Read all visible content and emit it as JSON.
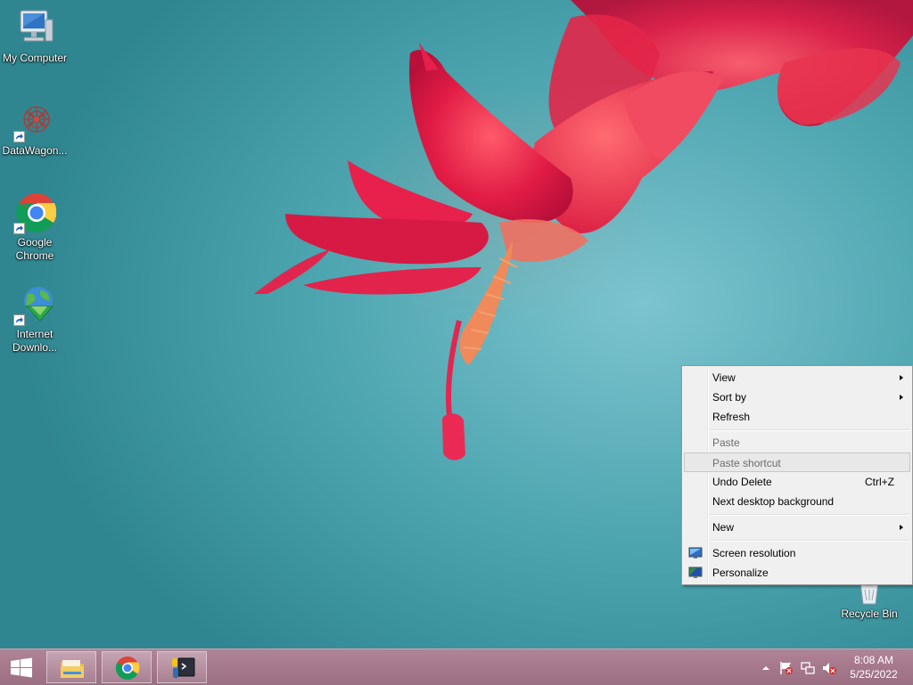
{
  "desktop": {
    "icons": [
      {
        "label": "My Computer",
        "icon": "my-computer-icon"
      },
      {
        "label": "DataWagon...",
        "icon": "datawagon-icon"
      },
      {
        "label_line1": "Google",
        "label_line2": "Chrome",
        "icon": "chrome-icon"
      },
      {
        "label_line1": "Internet",
        "label_line2": "Downlo...",
        "icon": "internet-download-manager-icon"
      },
      {
        "label": "Recycle Bin",
        "icon": "recycle-bin-icon"
      }
    ]
  },
  "context_menu": {
    "items": [
      {
        "label": "View",
        "submenu": true,
        "enabled": true
      },
      {
        "label": "Sort by",
        "submenu": true,
        "enabled": true
      },
      {
        "label": "Refresh",
        "enabled": true
      },
      {
        "label": "Paste",
        "enabled": false
      },
      {
        "label": "Paste shortcut",
        "enabled": false,
        "highlighted": true
      },
      {
        "label": "Undo Delete",
        "shortcut": "Ctrl+Z",
        "enabled": true
      },
      {
        "label": "Next desktop background",
        "enabled": true
      },
      {
        "label": "New",
        "submenu": true,
        "enabled": true
      },
      {
        "label": "Screen resolution",
        "icon": "screen-resolution-icon",
        "enabled": true
      },
      {
        "label": "Personalize",
        "icon": "personalize-icon",
        "enabled": true
      }
    ]
  },
  "taskbar": {
    "pinned": [
      {
        "name": "file-explorer",
        "icon": "folder-icon"
      },
      {
        "name": "google-chrome",
        "icon": "chrome-icon"
      },
      {
        "name": "python-launcher",
        "icon": "python-icon"
      }
    ],
    "tray_icons": [
      "show-hidden-icons-arrow",
      "action-center-flag-icon",
      "network-icon",
      "volume-muted-icon"
    ],
    "clock": {
      "time": "8:08 AM",
      "date": "5/25/2022"
    }
  },
  "colors": {
    "wallpaper_teal": "#4aa3ad",
    "flower_red": "#e0244a",
    "taskbar": "#a6788c",
    "menu_bg": "#f0f0f0"
  }
}
